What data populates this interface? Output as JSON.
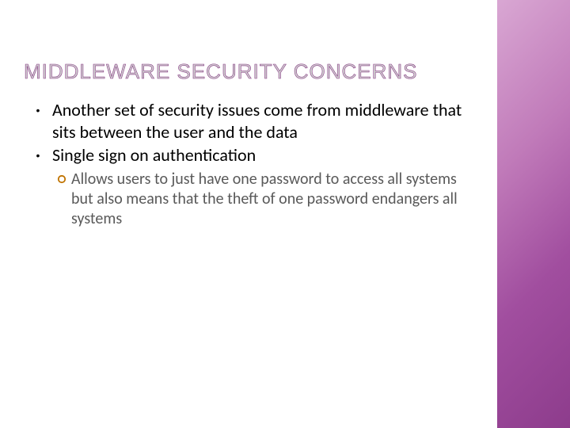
{
  "title": "MIDDLEWARE SECURITY CONCERNS",
  "bullets": [
    {
      "text": "Another set of security issues come from middleware that sits between the user and the data"
    },
    {
      "text": "Single sign on authentication",
      "sub": [
        {
          "text": "Allows users to just have one password to access all systems but also means that the theft of one password endangers all systems"
        }
      ]
    }
  ],
  "accent_color": "#a14e9f"
}
